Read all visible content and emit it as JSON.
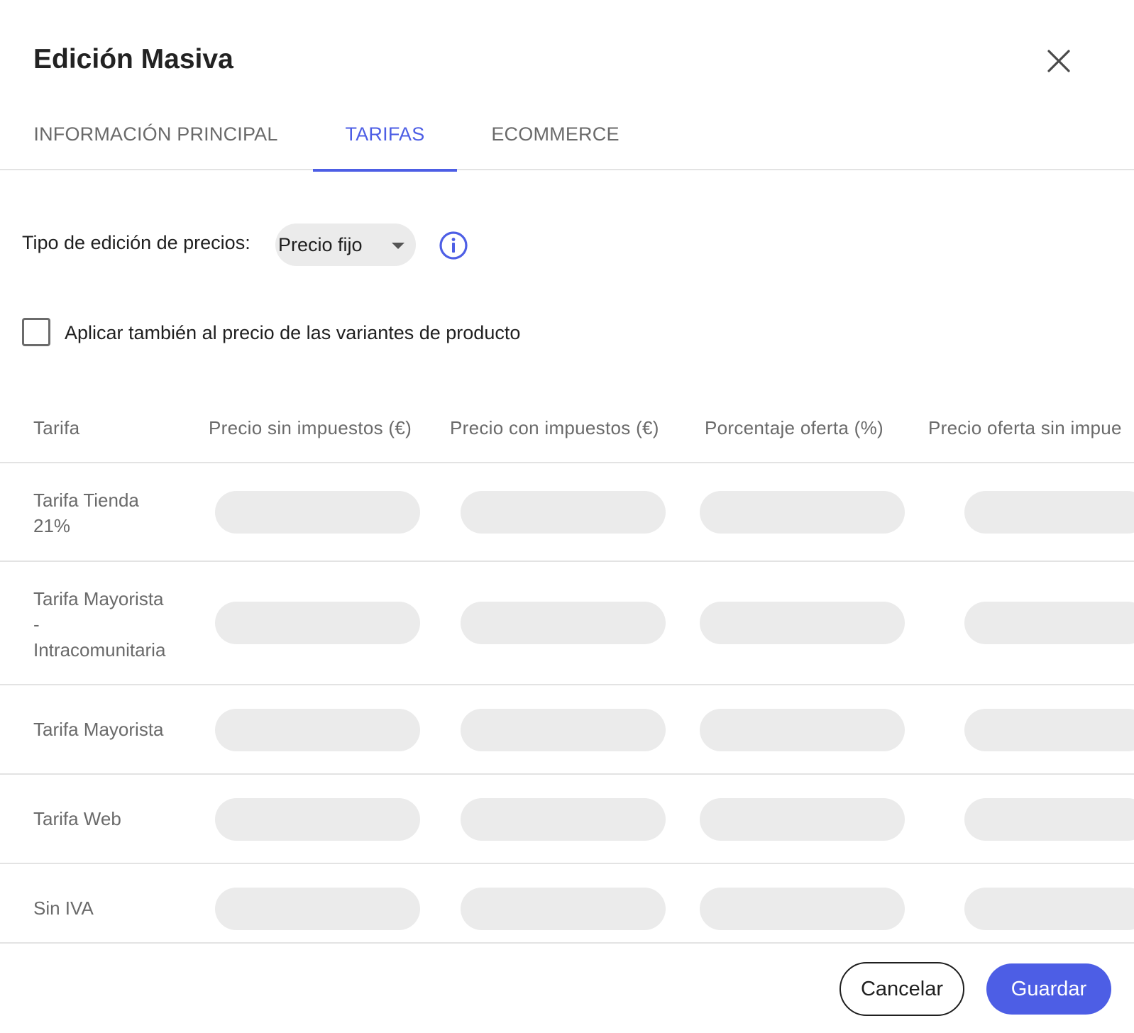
{
  "dialog": {
    "title": "Edición Masiva",
    "close_icon": "close-icon"
  },
  "tabs": [
    {
      "label": "INFORMACIÓN PRINCIPAL",
      "active": false
    },
    {
      "label": "TARIFAS",
      "active": true
    },
    {
      "label": "ECOMMERCE",
      "active": false
    }
  ],
  "price_type": {
    "label": "Tipo de edición de precios:",
    "selected": "Precio fijo",
    "caret_icon": "caret-down-icon",
    "info_icon": "info-icon"
  },
  "variants_checkbox": {
    "label": "Aplicar también al precio de las variantes de producto",
    "checked": false
  },
  "table": {
    "columns": [
      "Tarifa",
      "Precio sin impuestos (€)",
      "Precio con impuestos (€)",
      "Porcentaje oferta (%)",
      "Precio oferta sin impue"
    ],
    "rows": [
      {
        "name_lines": [
          "Tarifa Tienda",
          "21%"
        ]
      },
      {
        "name_lines": [
          "Tarifa Mayorista",
          "-",
          "Intracomunitaria"
        ]
      },
      {
        "name_lines": [
          "Tarifa Mayorista"
        ]
      },
      {
        "name_lines": [
          "Tarifa Web"
        ]
      },
      {
        "name_lines": [
          "Sin IVA"
        ]
      }
    ]
  },
  "footer": {
    "cancel_label": "Cancelar",
    "save_label": "Guardar"
  },
  "colors": {
    "accent": "#4d5ee5",
    "field_bg": "#ebebeb",
    "divider": "#e3e3e3",
    "muted_text": "#6a6a6a"
  }
}
